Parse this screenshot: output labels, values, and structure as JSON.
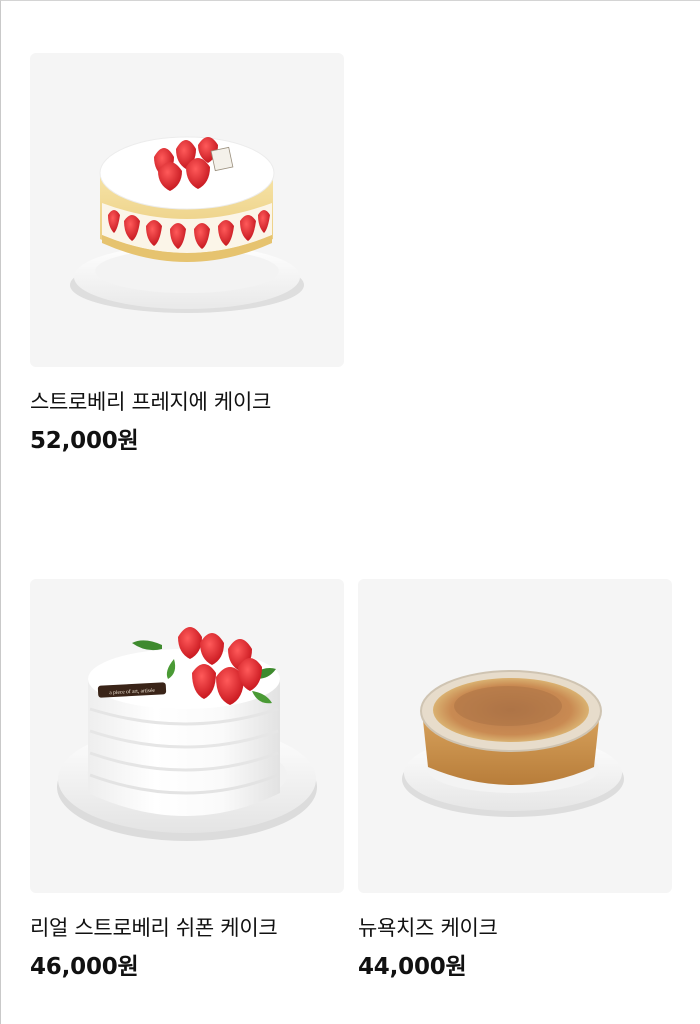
{
  "products": [
    {
      "name": "스트로베리 프레지에 케이크",
      "price": "52,000원",
      "image": "strawberry-fraisier-cake"
    },
    {
      "name": "리얼 스트로베리 쉬폰 케이크",
      "price": "46,000원",
      "image": "strawberry-chiffon-cake",
      "cake_tag": "a piece of art, artisée"
    },
    {
      "name": "뉴욕치즈 케이크",
      "price": "44,000원",
      "image": "new-york-cheesecake"
    }
  ]
}
